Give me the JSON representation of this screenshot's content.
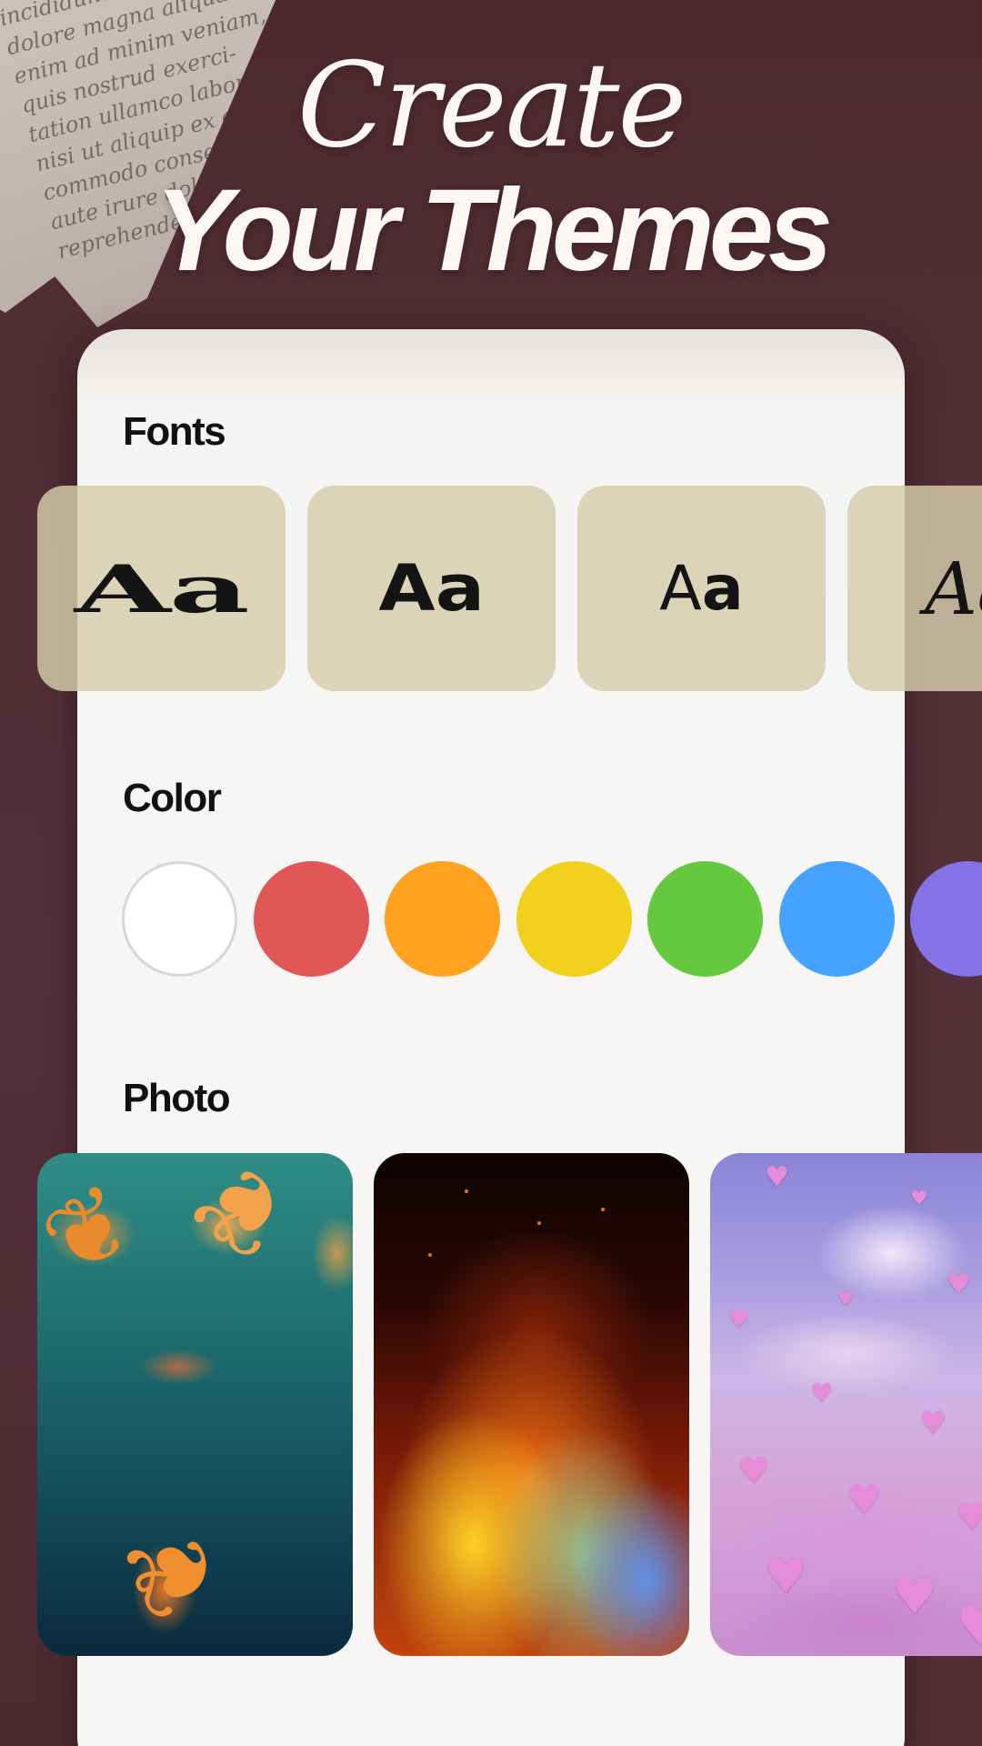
{
  "headline": {
    "line1": "Create",
    "line2": "Your Themes"
  },
  "sections": {
    "fonts_title": "Fonts",
    "color_title": "Color",
    "photo_title": "Photo"
  },
  "fonts": [
    {
      "sample": "Aa",
      "style": "heavy-serif"
    },
    {
      "sample": "Aa",
      "style": "rounded-geometric"
    },
    {
      "sample": "Aa",
      "style": "condensed-sans"
    },
    {
      "sample": "Aa",
      "style": "script"
    }
  ],
  "colors": [
    "#FFFFFF",
    "#E15656",
    "#FFA21F",
    "#F2D01E",
    "#64C93E",
    "#45A3FF",
    "#8373E6"
  ],
  "photos": [
    {
      "name": "autumn-leaves"
    },
    {
      "name": "fire-flames"
    },
    {
      "name": "pink-hearts-clouds"
    }
  ],
  "icons": {
    "heart": "♥",
    "leaf": "❦"
  }
}
